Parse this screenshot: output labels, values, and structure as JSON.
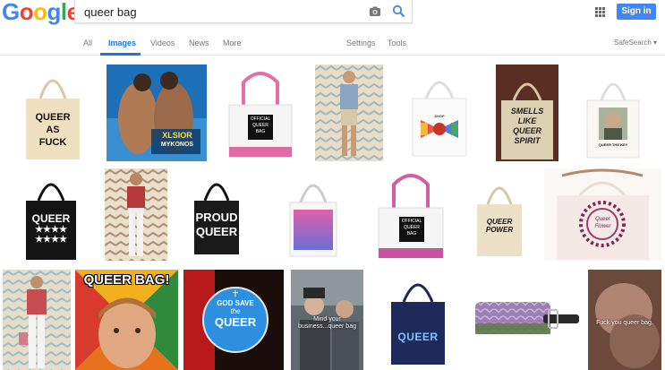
{
  "logo": {
    "letters": [
      "G",
      "o",
      "o",
      "g",
      "l",
      "e"
    ],
    "colors": [
      "#4285f4",
      "#ea4335",
      "#fbbc05",
      "#4285f4",
      "#34a853",
      "#ea4335"
    ]
  },
  "search": {
    "query": "queer bag"
  },
  "header": {
    "signin_label": "Sign in",
    "accent": "#4285f4"
  },
  "tabs": [
    {
      "label": "All"
    },
    {
      "label": "Images",
      "active": true
    },
    {
      "label": "Videos"
    },
    {
      "label": "News"
    },
    {
      "label": "More"
    },
    {
      "label": "Settings"
    },
    {
      "label": "Tools"
    }
  ],
  "safesearch_label": "SafeSearch ▾",
  "results": {
    "r1": {
      "lines": [
        "QUEER",
        "AS",
        "FUCK"
      ]
    },
    "r2": {
      "lines": [
        "XLSIOR",
        "MYKONOS"
      ]
    },
    "r3": {
      "lines": [
        "OFFICIAL",
        "QUEER",
        "BAG"
      ]
    },
    "r4": {},
    "r5": {
      "lines": [
        "SHOP",
        "QUEER"
      ]
    },
    "r6": {
      "lines": [
        "SMELLS",
        "LIKE",
        "QUEER",
        "SPIRIT"
      ]
    },
    "r7": {
      "lines": [
        "QUEER THE KEY"
      ]
    },
    "r8": {
      "lines": [
        "QUEER",
        "★★★★",
        "★★★★"
      ]
    },
    "r9": {},
    "r10": {
      "lines": [
        "PROUD",
        "QUEER"
      ]
    },
    "r11": {},
    "r12": {
      "lines": [
        "OFFICIAL",
        "QUEER",
        "BAG"
      ]
    },
    "r13": {
      "lines": [
        "QUEER",
        "POWER"
      ]
    },
    "r14": {
      "lines": [
        "Queer",
        "Flower"
      ]
    },
    "r15": {},
    "r16": {
      "lines": [
        "QUEER BAG!"
      ]
    },
    "r17": {
      "lines": [
        "GOD SAVE",
        "the",
        "QUEER"
      ]
    },
    "r18": {
      "lines": [
        "Mind your",
        "business...queer bag"
      ]
    },
    "r19": {
      "lines": [
        "QUEER"
      ]
    },
    "r20": {},
    "r21": {
      "lines": [
        "Fuck you queer bag."
      ]
    }
  }
}
